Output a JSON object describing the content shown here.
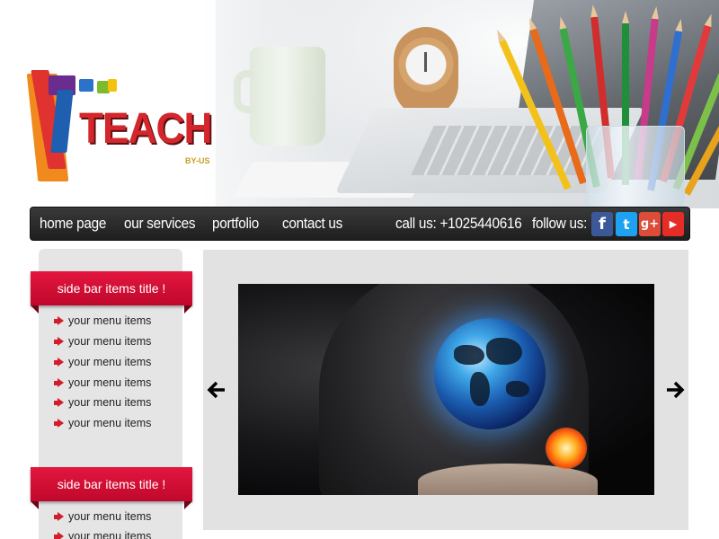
{
  "logo": {
    "text": "TEACH",
    "sub": "BY-US"
  },
  "nav": {
    "links": [
      "home page",
      "our services",
      "portfolio",
      "contact us"
    ],
    "call": "call us: +1025440616",
    "follow": "follow us:"
  },
  "social": [
    {
      "name": "facebook",
      "glyph": "f",
      "color": "#3b5998"
    },
    {
      "name": "twitter",
      "glyph": "t",
      "color": "#1da1f2"
    },
    {
      "name": "google-plus",
      "glyph": "g+",
      "color": "#dd4b39"
    },
    {
      "name": "youtube",
      "glyph": "▶",
      "color": "#e52d27"
    }
  ],
  "sidebar": {
    "blocks": [
      {
        "title": "side bar items title !",
        "items": [
          "your menu items",
          "your menu items",
          "your menu items",
          "your menu items",
          "your menu items",
          "your menu items"
        ]
      },
      {
        "title": "side bar items title !",
        "items": [
          "your menu items",
          "your menu items"
        ]
      }
    ]
  },
  "slider": {
    "prev_icon": "arrow-left-icon",
    "next_icon": "arrow-right-icon"
  }
}
